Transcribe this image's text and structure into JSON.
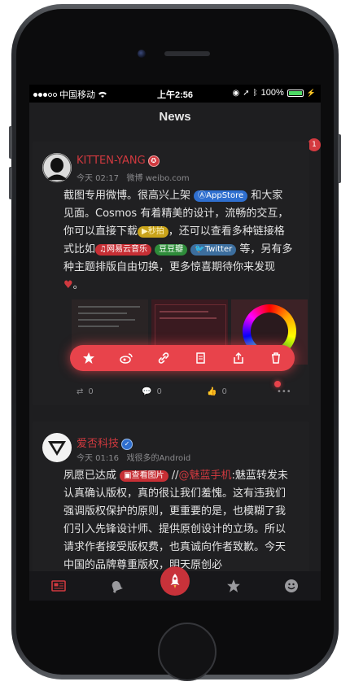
{
  "status_bar": {
    "carrier": "中国移动",
    "time": "上午2:56",
    "battery": "100%"
  },
  "nav": {
    "title": "News"
  },
  "badge_count": "1",
  "posts": [
    {
      "username": "KITTEN-YANG",
      "time": "今天 02:17",
      "source": "微博 weibo.com",
      "text_1": "截图专用微博。很高兴上架",
      "tag_appstore": "AppStore",
      "text_2": "和大家见面。Cosmos 有着精美的设计，流畅的交互，你可以直接下载",
      "tag_miaopai": "秒拍",
      "text_3": "，还可以查看多种链接格式比如",
      "tag_music": "网易云音乐",
      "tag_douban": "豆瓣",
      "tag_twitter": "Twitter",
      "text_4": "等，另有多种主题排版自由切换，更多惊喜期待你来发现",
      "text_5": "。",
      "stats": {
        "reposts": "0",
        "comments": "0",
        "likes": "0"
      }
    },
    {
      "username": "爱否科技",
      "time": "今天 01:16",
      "source": "戏很多的Android",
      "text_1": "夙愿已达成",
      "tag_image": "查看图片",
      "text_2": "//",
      "mention": "@魅蓝手机",
      "text_3": ":魅蓝转发未认真确认版权，真的很让我们羞愧。这有违我们强调版权保护的原则，更重要的是，也模糊了我们引入先锋设计师、提供原创设计的立场。所以请求作者接受版权费，也真诚向作者致歉。今天中国的品牌尊重版权，明天原创必"
    }
  ],
  "colors": {
    "accent": "#d0393f",
    "background": "#1e1e20"
  },
  "icons": {
    "actions": [
      "star-icon",
      "weibo-icon",
      "link-icon",
      "copy-icon",
      "share-icon",
      "trash-icon"
    ],
    "tabs": [
      "news-icon",
      "bell-icon",
      "rocket-icon",
      "star-icon",
      "smile-icon"
    ]
  }
}
